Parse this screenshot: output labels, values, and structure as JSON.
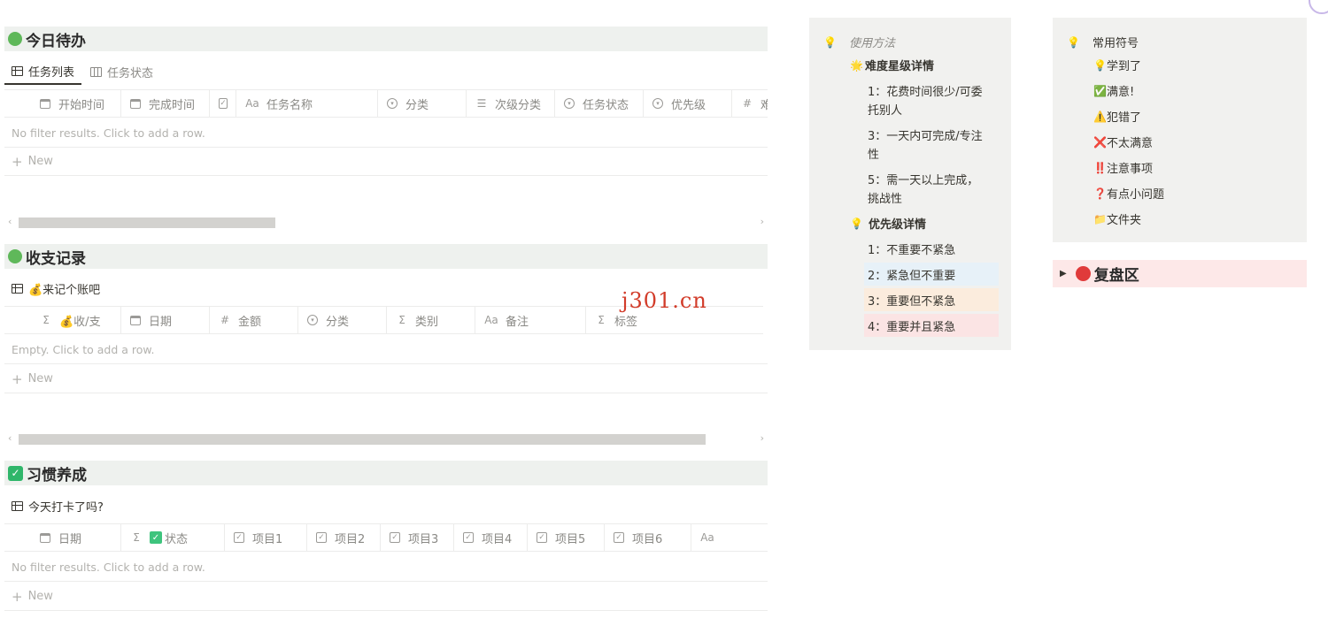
{
  "todo": {
    "title": "今日待办",
    "tabs": [
      {
        "label": "任务列表",
        "icon": "table-icon"
      },
      {
        "label": "任务状态",
        "icon": "board-icon"
      }
    ],
    "columns": [
      {
        "label": "开始时间",
        "icon": "calendar-icon"
      },
      {
        "label": "完成时间",
        "icon": "calendar-icon"
      },
      {
        "label": "",
        "icon": "checkbox-icon"
      },
      {
        "label": "任务名称",
        "icon": "text-icon"
      },
      {
        "label": "分类",
        "icon": "select-icon"
      },
      {
        "label": "次级分类",
        "icon": "multiselect-icon"
      },
      {
        "label": "任务状态",
        "icon": "select-icon"
      },
      {
        "label": "优先级",
        "icon": "select-icon"
      },
      {
        "label": "难度星",
        "icon": "number-icon"
      }
    ],
    "empty_text": "No filter results. Click to add a row.",
    "new_label": "New"
  },
  "finance": {
    "title": "收支记录",
    "view_label": "💰来记个账吧",
    "columns": [
      {
        "label": "💰收/支",
        "icon": "formula-icon"
      },
      {
        "label": "日期",
        "icon": "calendar-icon"
      },
      {
        "label": "金额",
        "icon": "number-icon"
      },
      {
        "label": "分类",
        "icon": "select-icon"
      },
      {
        "label": "类别",
        "icon": "formula-icon"
      },
      {
        "label": "备注",
        "icon": "text-icon"
      },
      {
        "label": "标签",
        "icon": "formula-icon"
      }
    ],
    "empty_text": "Empty. Click to add a row.",
    "new_label": "New"
  },
  "habit": {
    "title": "习惯养成",
    "view_label": "今天打卡了吗?",
    "columns": [
      {
        "label": "日期",
        "icon": "calendar-icon"
      },
      {
        "label": "状态",
        "icon": "formula-icon"
      },
      {
        "label": "项目1",
        "icon": "checkbox-icon"
      },
      {
        "label": "项目2",
        "icon": "checkbox-icon"
      },
      {
        "label": "项目3",
        "icon": "checkbox-icon"
      },
      {
        "label": "项目4",
        "icon": "checkbox-icon"
      },
      {
        "label": "项目5",
        "icon": "checkbox-icon"
      },
      {
        "label": "项目6",
        "icon": "checkbox-icon"
      },
      {
        "label": "",
        "icon": "text-icon"
      }
    ],
    "empty_text": "No filter results. Click to add a row.",
    "new_label": "New"
  },
  "watermark": "j301.cn",
  "usage": {
    "title": "使用方法",
    "difficulty_title": "难度星级详情",
    "difficulty_items": [
      "1：花费时间很少/可委",
      "托别人",
      "3：一天内可完成/专注",
      "性",
      "5：需一天以上完成，",
      "挑战性"
    ],
    "priority_title": "优先级详情",
    "priority_items": [
      {
        "label": "1：不重要不紧急",
        "color": "#f1f1ef"
      },
      {
        "label": "2：紧急但不重要",
        "color": "#e7f1f8"
      },
      {
        "label": "3：重要但不紧急",
        "color": "#fbecdd"
      },
      {
        "label": "4：重要并且紧急",
        "color": "#fbe4e4"
      }
    ]
  },
  "symbols": {
    "title": "常用符号",
    "items": [
      {
        "glyph": "💡",
        "label": "学到了"
      },
      {
        "glyph": "✅",
        "label": "满意!"
      },
      {
        "glyph": "⚠️",
        "label": "犯错了"
      },
      {
        "glyph": "❌",
        "label": "不太满意"
      },
      {
        "glyph": "‼️",
        "label": "注意事项"
      },
      {
        "glyph": "❓",
        "label": "有点小问题"
      },
      {
        "glyph": "📁",
        "label": "文件夹"
      }
    ]
  },
  "review": {
    "title": "复盘区"
  },
  "colors": {
    "green_dot": "#5fb85a",
    "red_dot": "#e03a3a",
    "callout_bg": "#f1f1ef",
    "header_bg": "#eef1ee"
  }
}
